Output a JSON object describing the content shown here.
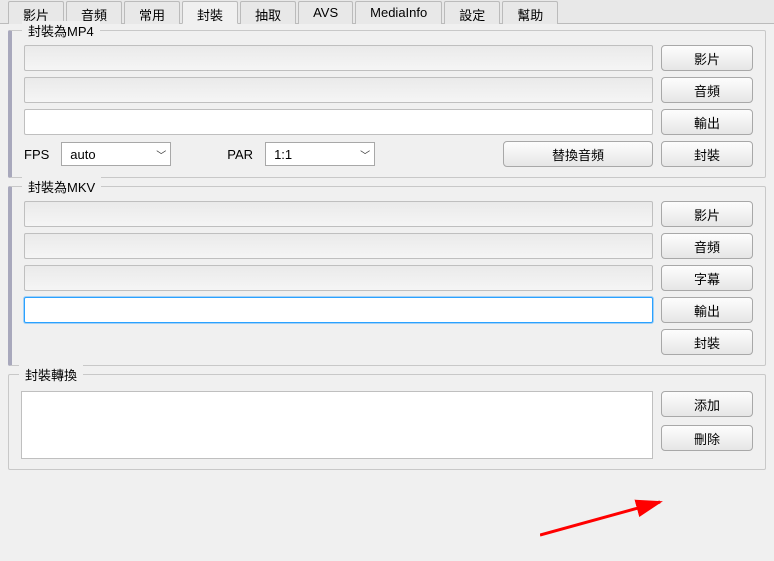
{
  "tabs": {
    "video": "影片",
    "audio": "音頻",
    "common": "常用",
    "mux": "封裝",
    "extract": "抽取",
    "avs": "AVS",
    "mediainfo": "MediaInfo",
    "settings": "設定",
    "help": "幫助"
  },
  "mp4": {
    "title": "封裝為MP4",
    "fps_label": "FPS",
    "fps_value": "auto",
    "par_label": "PAR",
    "par_value": "1:1",
    "replace_audio_btn": "替換音頻",
    "btn_video": "影片",
    "btn_audio": "音頻",
    "btn_output": "輸出",
    "btn_mux": "封裝"
  },
  "mkv": {
    "title": "封裝為MKV",
    "btn_video": "影片",
    "btn_audio": "音頻",
    "btn_subtitle": "字幕",
    "btn_output": "輸出",
    "btn_mux": "封裝"
  },
  "convert": {
    "title": "封裝轉換",
    "btn_add": "添加",
    "btn_delete": "刪除"
  }
}
